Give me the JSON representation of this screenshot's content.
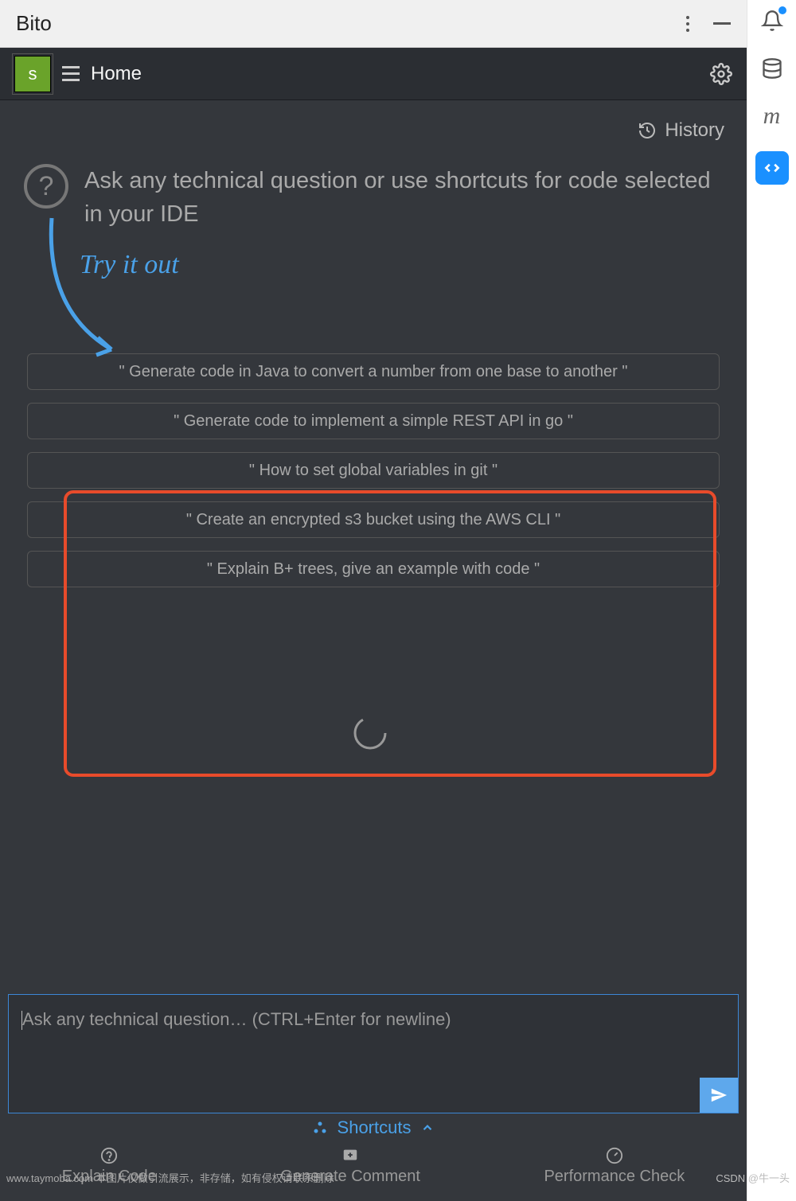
{
  "titlebar": {
    "app_name": "Bito"
  },
  "avatar_initial": "s",
  "tab": {
    "label": "Home"
  },
  "history_label": "History",
  "intro_text": "Ask any technical question or use shortcuts for code selected in your IDE",
  "try_label": "Try it out",
  "suggestions": [
    "\" Generate code in Java to convert a number from one base to another \"",
    "\" Generate code to implement a simple REST API in go \"",
    "\" How to set global variables in git \"",
    "\" Create an encrypted s3 bucket using the AWS CLI \"",
    "\" Explain B+ trees, give an example with code \""
  ],
  "input": {
    "placeholder": "Ask any technical question… (CTRL+Enter for newline)"
  },
  "shortcuts_label": "Shortcuts",
  "bottom_actions": [
    {
      "label": "Explain Code"
    },
    {
      "label": "Generate Comment"
    },
    {
      "label": "Performance Check"
    }
  ],
  "watermark_left": "www.taymoba.com 本图片仅做引流展示，非存储，如有侵权请联系删除",
  "watermark_right": "CSDN @牛一头"
}
